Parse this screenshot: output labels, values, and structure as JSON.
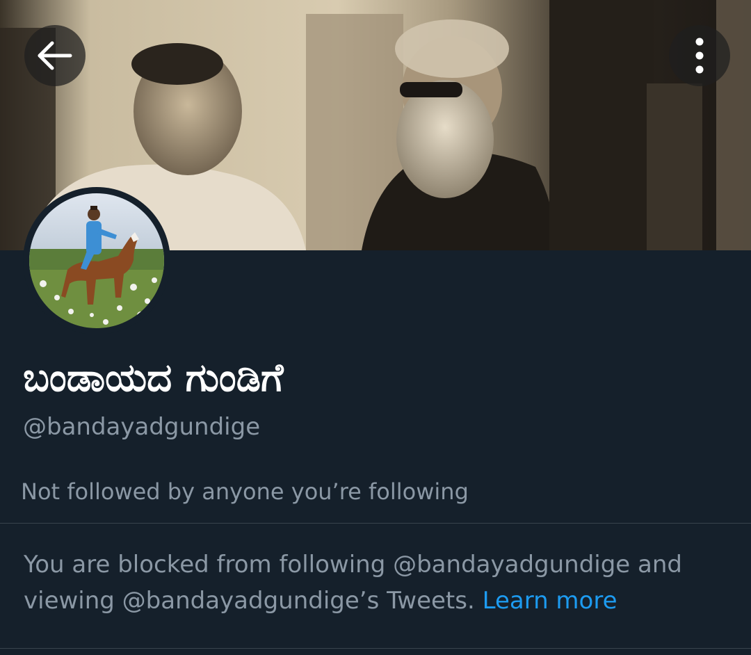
{
  "header": {
    "back_icon": "arrow-left-icon",
    "more_icon": "more-vertical-icon"
  },
  "profile": {
    "display_name": "ಬಂಡಾಯದ ಗುಂಡಿಗೆ",
    "handle": "@bandayadgundige",
    "followed_by_note": "Not followed by anyone you’re following"
  },
  "blocked": {
    "message": "You are blocked from following @bandayadgundige and viewing @bandayadgundige’s Tweets.",
    "link_label": "Learn more"
  },
  "colors": {
    "background": "#15202b",
    "text_primary": "#ffffff",
    "text_secondary": "#8b98a5",
    "link": "#1d9bf0",
    "divider": "#38444d"
  }
}
